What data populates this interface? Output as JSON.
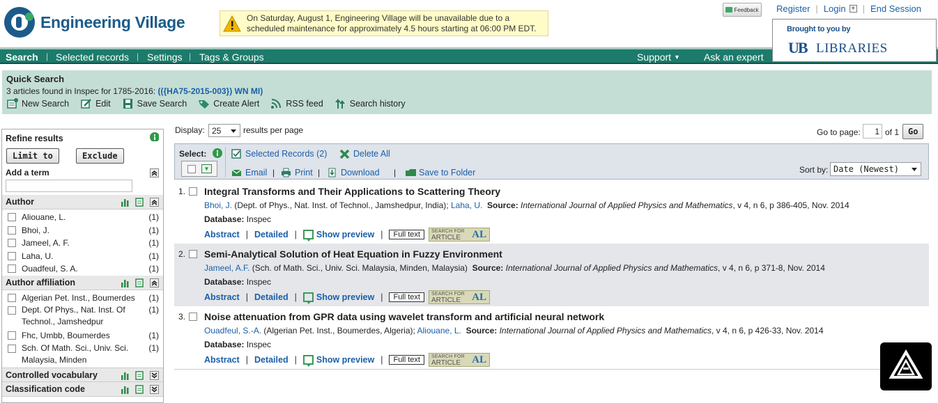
{
  "app": {
    "name": "Engineering Village"
  },
  "alert": {
    "text_line1": "On Saturday, August 1, Engineering Village will be unavailable due to a",
    "text_line2": "scheduled maintenance for approximately 4.5 hours starting at 06:00 PM EDT."
  },
  "feedback": {
    "label": "Feedback"
  },
  "toplinks": {
    "register": "Register",
    "login": "Login",
    "end_session": "End Session"
  },
  "brought": {
    "label": "Brought to you by",
    "ub": "UB",
    "libraries": "LIBRARIES"
  },
  "nav": {
    "search": "Search",
    "selected": "Selected records",
    "settings": "Settings",
    "tags": "Tags & Groups",
    "support": "Support",
    "ask": "Ask an expert"
  },
  "quick_search": {
    "title": "Quick Search",
    "count_text": "3 articles found in Inspec for 1785-2016: ",
    "query": "(({HA75-2015-003}) WN MI)",
    "actions": [
      "New Search",
      "Edit",
      "Save Search",
      "Create Alert",
      "RSS feed",
      "Search history"
    ]
  },
  "refine": {
    "title": "Refine results",
    "limit": "Limit to",
    "exclude": "Exclude",
    "add_term": "Add a term",
    "author_title": "Author",
    "authors": [
      {
        "name": "Aliouane, L.",
        "count": "(1)"
      },
      {
        "name": "Bhoi, J.",
        "count": "(1)"
      },
      {
        "name": "Jameel, A. F.",
        "count": "(1)"
      },
      {
        "name": "Laha, U.",
        "count": "(1)"
      },
      {
        "name": "Ouadfeul, S. A.",
        "count": "(1)"
      }
    ],
    "affil_title": "Author affiliation",
    "affiliations": [
      {
        "line1": "Algerian Pet. Inst., Boumerdes",
        "line2": "",
        "count": "(1)"
      },
      {
        "line1": "Dept. Of Phys., Nat. Inst. Of",
        "line2": "Technol., Jamshedpur",
        "count": "(1)"
      },
      {
        "line1": "Fhc, Umbb, Boumerdes",
        "line2": "",
        "count": "(1)"
      },
      {
        "line1": "Sch. Of Math. Sci., Univ. Sci.",
        "line2": "Malaysia, Minden",
        "count": "(1)"
      }
    ],
    "controlled_title": "Controlled vocabulary",
    "classification_title": "Classification code"
  },
  "display": {
    "label": "Display:",
    "value": "25",
    "suffix": "results per page"
  },
  "goto": {
    "label": "Go to page:",
    "value": "1",
    "of": "of 1",
    "button": "Go"
  },
  "toolbar": {
    "select": "Select:",
    "selected_records": "Selected Records (2)",
    "delete_all": "Delete All",
    "email": "Email",
    "print": "Print",
    "download": "Download",
    "save_folder": "Save to Folder",
    "sort_label": "Sort by:",
    "sort_value": "Date (Newest)"
  },
  "results": [
    {
      "num": "1.",
      "title": "Integral Transforms and Their Applications to Scattering Theory",
      "author1": "Bhoi, J.",
      "affil1": " (Dept. of Phys., Nat. Inst. of Technol., Jamshedpur, India); ",
      "author2": "Laha, U.",
      "source_label": "Source:",
      "journal": "International Journal of Applied Physics and Mathematics",
      "details": ", v 4, n 6, p 386-405, Nov. 2014",
      "db_label": "Database:",
      "db": " Inspec"
    },
    {
      "num": "2.",
      "title": "Semi-Analytical Solution of Heat Equation in Fuzzy Environment",
      "author1": "Jameel, A.F.",
      "affil1": " (Sch. of Math. Sci., Univ. Sci. Malaysia, Minden, Malaysia) ",
      "author2": "",
      "source_label": "Source:",
      "journal": "International Journal of Applied Physics and Mathematics",
      "details": ", v 4, n 6, p 371-8, Nov. 2014",
      "db_label": "Database:",
      "db": " Inspec"
    },
    {
      "num": "3.",
      "title": "Noise attenuation from GPR data using wavelet transform and artificial neural network",
      "author1": "Ouadfeul, S.-A.",
      "affil1": " (Algerian Pet. Inst., Boumerdes, Algeria); ",
      "author2": "Aliouane, L.",
      "source_label": "Source:",
      "journal": "International Journal of Applied Physics and Mathematics",
      "details": ", v 4, n 6, p 426-33, Nov. 2014",
      "db_label": "Database:",
      "db": " Inspec"
    }
  ],
  "result_links": {
    "abstract": "Abstract",
    "detailed": "Detailed",
    "preview": "Show preview",
    "fulltext": "Full text",
    "sfa1": "SEARCH FOR",
    "sfa2": "ARTICLE",
    "sfa3": "AL"
  }
}
